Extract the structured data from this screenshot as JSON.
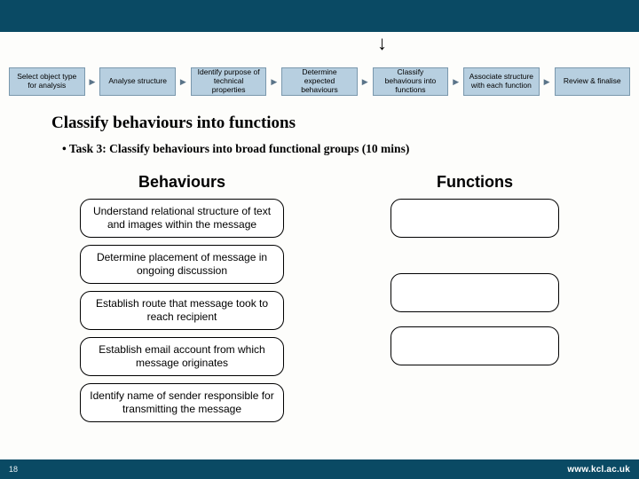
{
  "colors": {
    "band": "#0a4a64",
    "flow_fill": "#b7cfe0"
  },
  "down_arrow": "↓",
  "flow_steps": [
    "Select object type for analysis",
    "Analyse structure",
    "Identify purpose of technical properties",
    "Determine expected behaviours",
    "Classify behaviours into functions",
    "Associate structure with each function",
    "Review & finalise"
  ],
  "title": "Classify behaviours into functions",
  "bullet": "• Task 3: Classify behaviours into broad functional groups (10 mins)",
  "columns": {
    "behaviours_header": "Behaviours",
    "functions_header": "Functions",
    "behaviours": [
      "Understand relational structure of text and images within the message",
      "Determine placement of message in ongoing discussion",
      "Establish route that message took to reach recipient",
      "Establish email account from which message originates",
      "Identify name of sender responsible for transmitting the message"
    ],
    "functions_empty_count": 3
  },
  "footer": {
    "page": "18",
    "url": "www.kcl.ac.uk"
  }
}
